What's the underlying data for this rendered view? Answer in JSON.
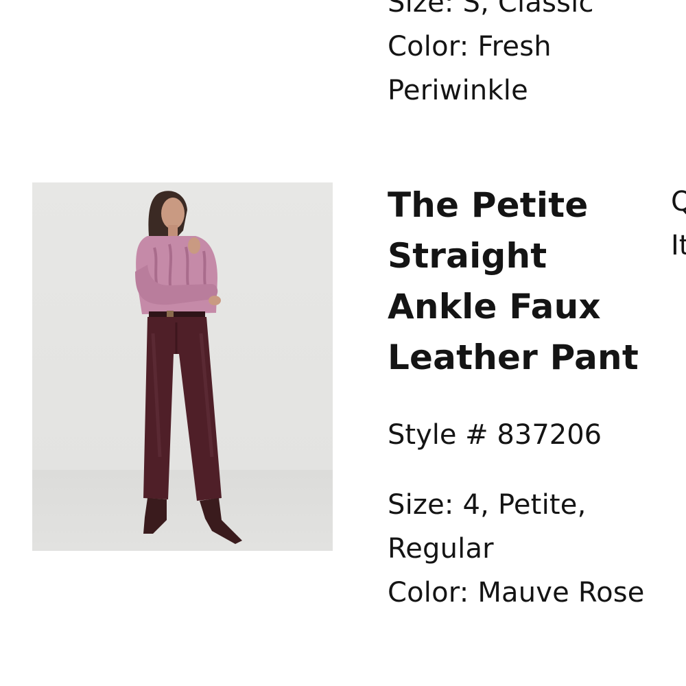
{
  "previous_item": {
    "size": "Size: S, Classic",
    "color": "Color: Fresh Periwinkle"
  },
  "current_item": {
    "title": "The Petite Straight Ankle Faux Leather Pant",
    "style": "Style # 837206",
    "size": "Size: 4, Petite, Regular",
    "color": "Color: Mauve Rose",
    "image_alt": "model-wearing-petite-straight-ankle-faux-leather-pant",
    "quantity_label": "Q",
    "item_price_label": "It"
  },
  "colors": {
    "text": "#141414",
    "background": "#ffffff",
    "sweater": "#c58aa8",
    "pants": "#4f1f28",
    "boots": "#3a1b1d",
    "image_backdrop": "#e5e5e3"
  }
}
